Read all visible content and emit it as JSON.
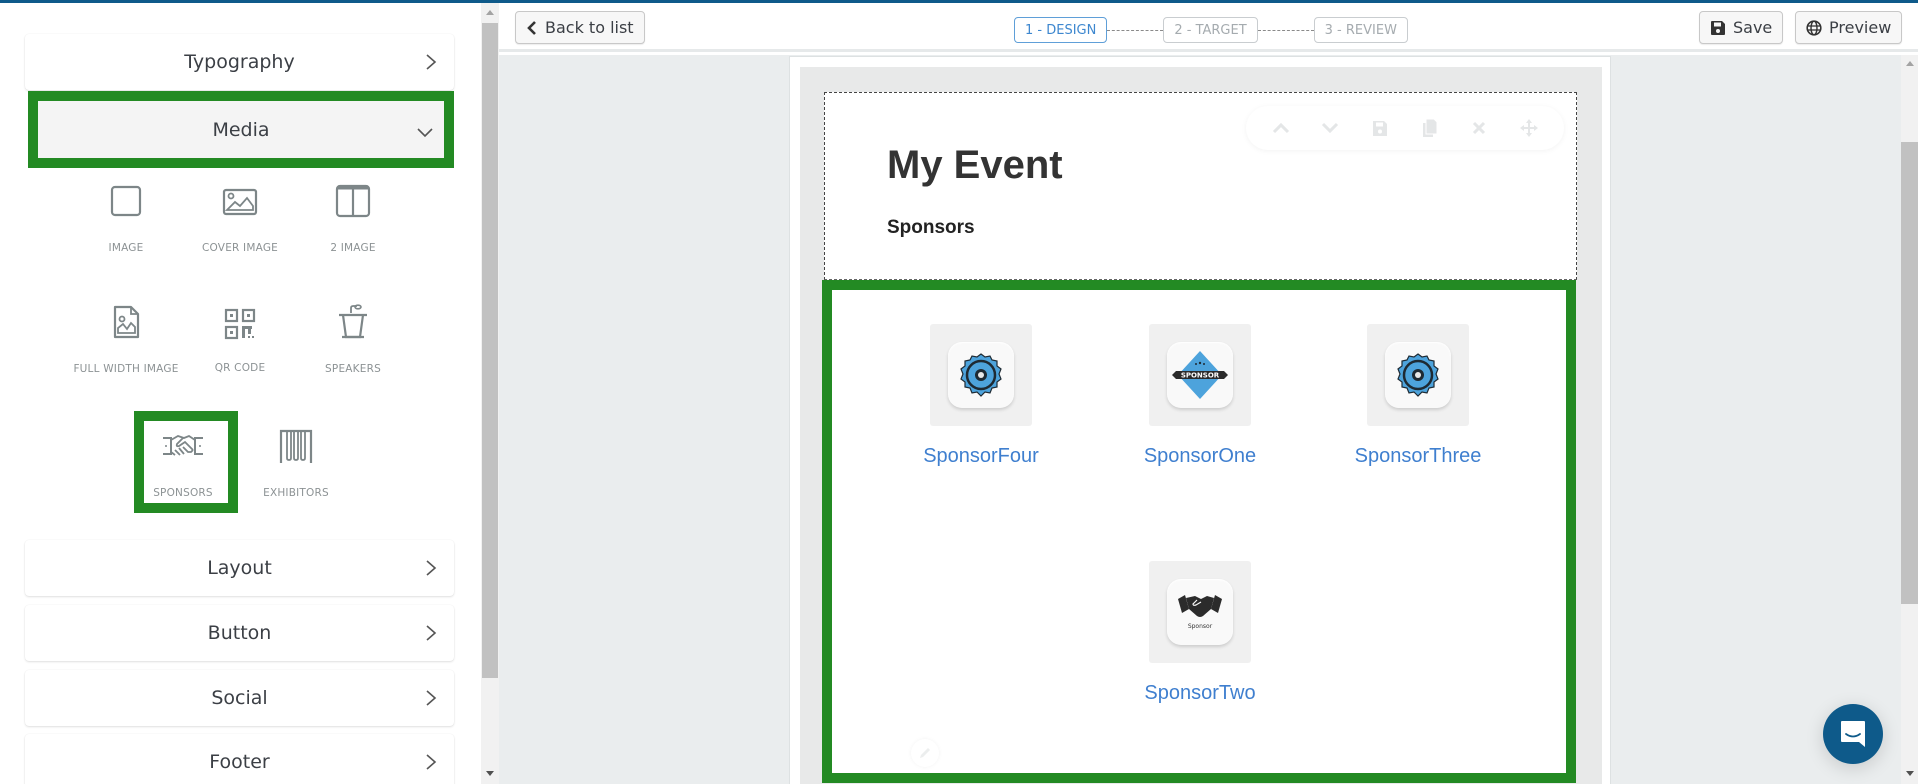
{
  "sidebar": {
    "sections": {
      "typography": "Typography",
      "media": "Media",
      "layout": "Layout",
      "button": "Button",
      "social": "Social",
      "footer": "Footer"
    },
    "media_tiles": [
      {
        "label": "IMAGE",
        "icon": "image-icon"
      },
      {
        "label": "COVER IMAGE",
        "icon": "cover-image-icon"
      },
      {
        "label": "2 IMAGE",
        "icon": "two-image-icon"
      },
      {
        "label": "FULL WIDTH IMAGE",
        "icon": "full-width-image-icon"
      },
      {
        "label": "QR CODE",
        "icon": "qr-code-icon"
      },
      {
        "label": "SPEAKERS",
        "icon": "podium-icon"
      },
      {
        "label": "SPONSORS",
        "icon": "handshake-icon",
        "highlighted": true
      },
      {
        "label": "EXHIBITORS",
        "icon": "exhibitors-icon"
      }
    ],
    "media_expanded": true
  },
  "toolbar": {
    "back_label": "Back to list",
    "steps": [
      {
        "label": "1 - DESIGN",
        "active": true
      },
      {
        "label": "2 - TARGET",
        "active": false
      },
      {
        "label": "3 - REVIEW",
        "active": false
      }
    ],
    "save_label": "Save",
    "preview_label": "Preview"
  },
  "canvas": {
    "title": "My Event",
    "subtitle": "Sponsors",
    "block_tools": [
      "move-up-icon",
      "move-down-icon",
      "save-icon",
      "duplicate-icon",
      "delete-icon",
      "drag-icon"
    ],
    "sponsors": [
      {
        "name": "SponsorFour",
        "logo": "badge-seal"
      },
      {
        "name": "SponsorOne",
        "logo": "badge-diamond",
        "logo_text": "SPONSOR"
      },
      {
        "name": "SponsorThree",
        "logo": "badge-seal"
      },
      {
        "name": "SponsorTwo",
        "logo": "handshake",
        "logo_text": "Sponsor"
      }
    ]
  },
  "colors": {
    "brand": "#0e5a8a",
    "highlight": "#238a23",
    "link": "#3f7fcf",
    "active_step": "#3d87cf",
    "badge_blue": "#4da3dc"
  }
}
